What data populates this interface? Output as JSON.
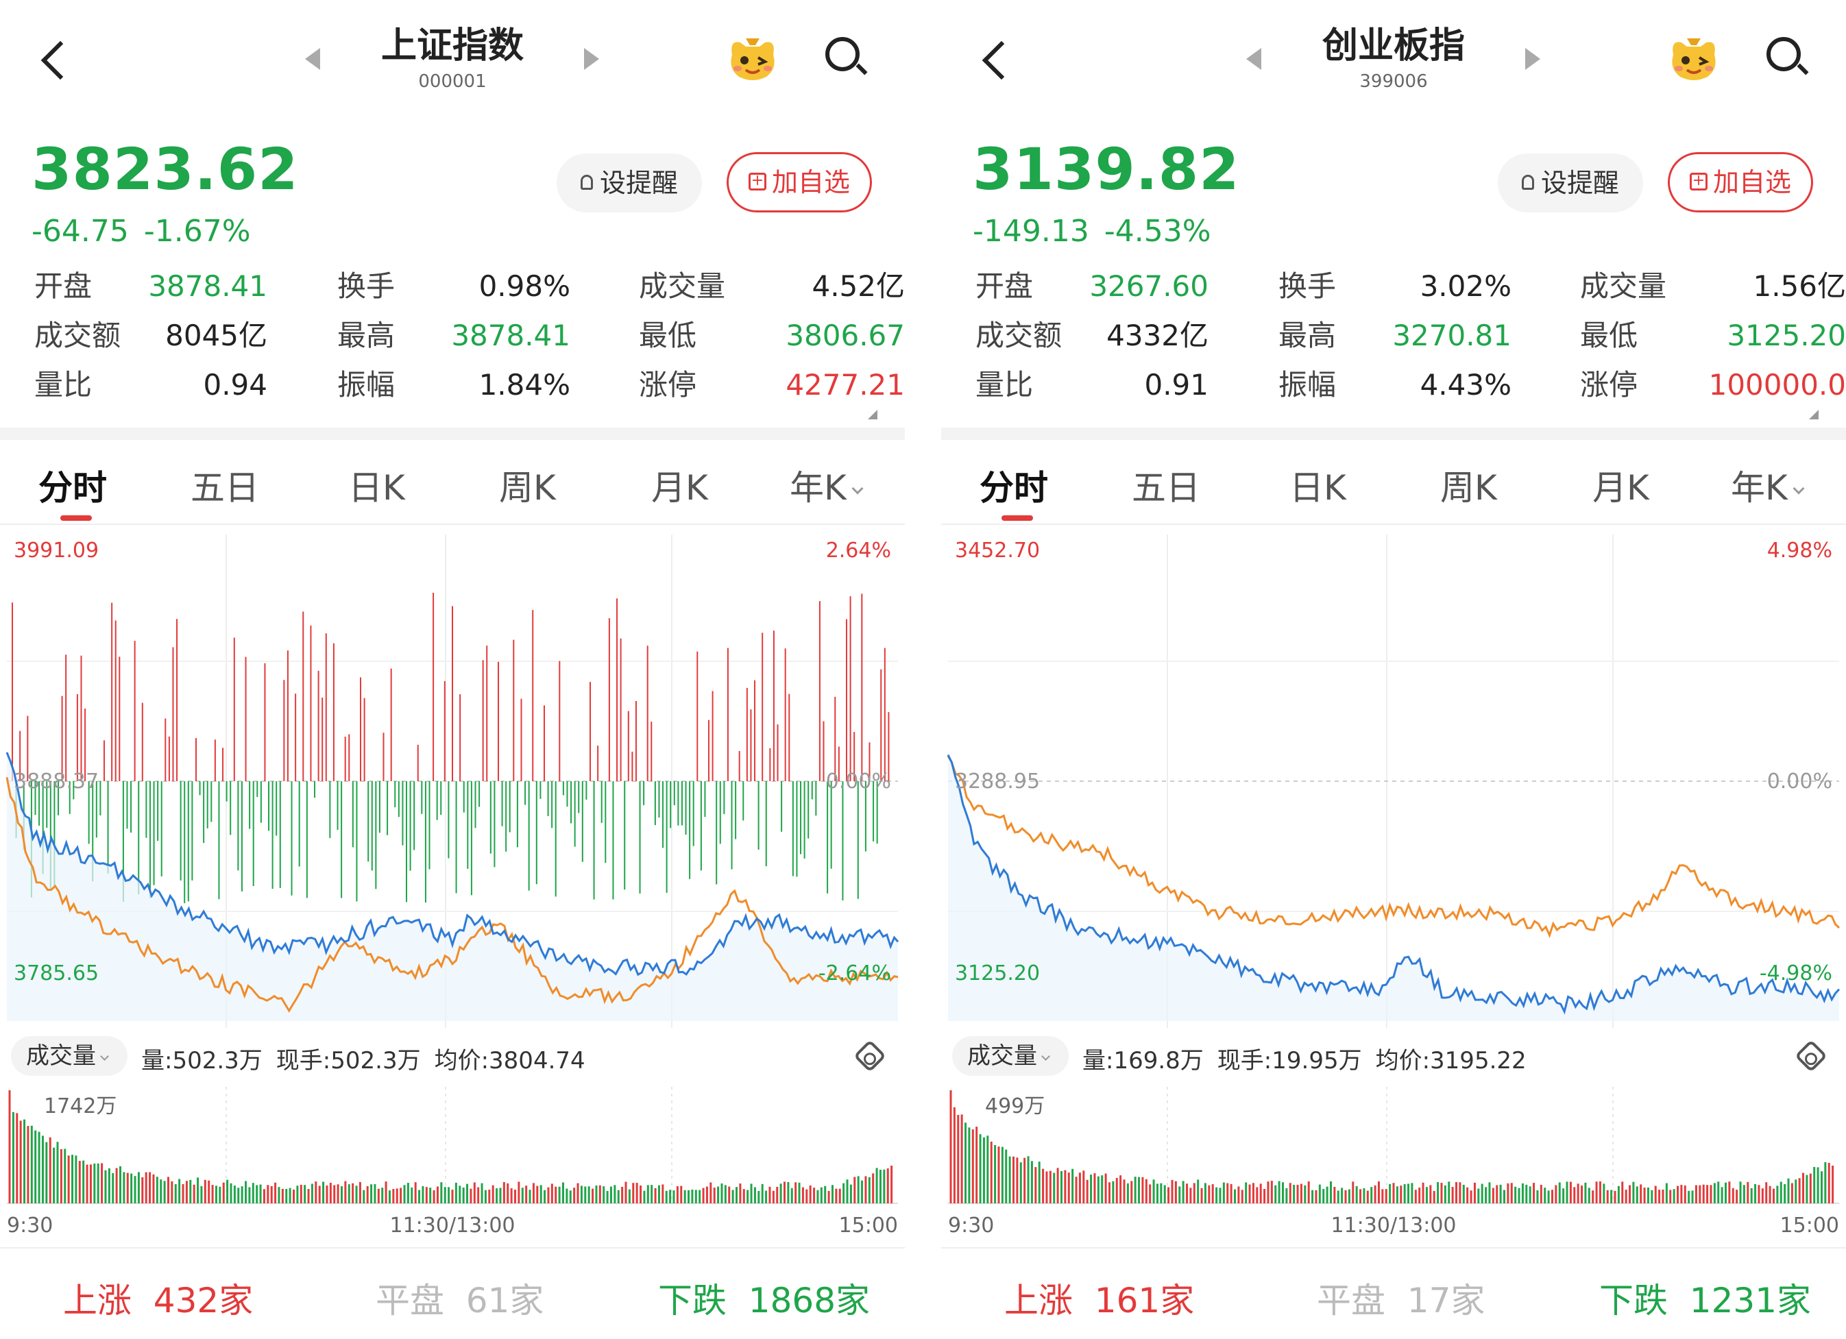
{
  "panels": [
    {
      "header": {
        "title": "上证指数",
        "code": "000001"
      },
      "quote": {
        "price": "3823.62",
        "change": "-64.75",
        "change_pct": "-1.67%"
      },
      "buttons": {
        "remind": "设提醒",
        "watchlist": "加自选"
      },
      "stats": [
        [
          {
            "label": "开盘",
            "value": "3878.41",
            "color": "green"
          },
          {
            "label": "换手",
            "value": "0.98%",
            "color": "dark"
          },
          {
            "label": "成交量",
            "value": "4.52亿",
            "color": "dark"
          }
        ],
        [
          {
            "label": "成交额",
            "value": "8045亿",
            "color": "dark"
          },
          {
            "label": "最高",
            "value": "3878.41",
            "color": "green"
          },
          {
            "label": "最低",
            "value": "3806.67",
            "color": "green"
          }
        ],
        [
          {
            "label": "量比",
            "value": "0.94",
            "color": "dark"
          },
          {
            "label": "振幅",
            "value": "1.84%",
            "color": "dark"
          },
          {
            "label": "涨停",
            "value": "4277.21",
            "color": "red"
          }
        ]
      ],
      "tabs": [
        "分时",
        "五日",
        "日K",
        "周K",
        "月K",
        "年K"
      ],
      "chart": {
        "y_high": "3991.09",
        "y_mid": "3888.37",
        "y_low": "3785.65",
        "pct_high": "2.64%",
        "pct_mid": "0.00%",
        "pct_low": "-2.64%"
      },
      "volume": {
        "toggle": "成交量",
        "vol": "量:502.3万",
        "current": "现手:502.3万",
        "avg": "均价:3804.74",
        "max_label": "1742万"
      },
      "time_axis": [
        "9:30",
        "11:30/13:00",
        "15:00"
      ],
      "breadth": {
        "up_label": "上涨",
        "up_count": "432家",
        "flat_label": "平盘",
        "flat_count": "61家",
        "down_label": "下跌",
        "down_count": "1868家"
      }
    },
    {
      "header": {
        "title": "创业板指",
        "code": "399006"
      },
      "quote": {
        "price": "3139.82",
        "change": "-149.13",
        "change_pct": "-4.53%"
      },
      "buttons": {
        "remind": "设提醒",
        "watchlist": "加自选"
      },
      "stats": [
        [
          {
            "label": "开盘",
            "value": "3267.60",
            "color": "green"
          },
          {
            "label": "换手",
            "value": "3.02%",
            "color": "dark"
          },
          {
            "label": "成交量",
            "value": "1.56亿",
            "color": "dark"
          }
        ],
        [
          {
            "label": "成交额",
            "value": "4332亿",
            "color": "dark"
          },
          {
            "label": "最高",
            "value": "3270.81",
            "color": "green"
          },
          {
            "label": "最低",
            "value": "3125.20",
            "color": "green"
          }
        ],
        [
          {
            "label": "量比",
            "value": "0.91",
            "color": "dark"
          },
          {
            "label": "振幅",
            "value": "4.43%",
            "color": "dark"
          },
          {
            "label": "涨停",
            "value": "100000.0",
            "color": "red"
          }
        ]
      ],
      "tabs": [
        "分时",
        "五日",
        "日K",
        "周K",
        "月K",
        "年K"
      ],
      "chart": {
        "y_high": "3452.70",
        "y_mid": "3288.95",
        "y_low": "3125.20",
        "pct_high": "4.98%",
        "pct_mid": "0.00%",
        "pct_low": "-4.98%"
      },
      "volume": {
        "toggle": "成交量",
        "vol": "量:169.8万",
        "current": "现手:19.95万",
        "avg": "均价:3195.22",
        "max_label": "499万"
      },
      "time_axis": [
        "9:30",
        "11:30/13:00",
        "15:00"
      ],
      "breadth": {
        "up_label": "上涨",
        "up_count": "161家",
        "flat_label": "平盘",
        "flat_count": "17家",
        "down_label": "下跌",
        "down_count": "1231家"
      }
    }
  ],
  "colors": {
    "up": "#e33a3a",
    "down": "#1fa54a",
    "price_line": "#2f7bd6",
    "avg_line": "#f08c2a",
    "flat": "#bbbbbb"
  },
  "icons": [
    "back-arrow-icon",
    "prev-triangle-icon",
    "next-triangle-icon",
    "mascot-icon",
    "search-icon",
    "bell-icon",
    "plus-box-icon",
    "settings-icon"
  ]
}
